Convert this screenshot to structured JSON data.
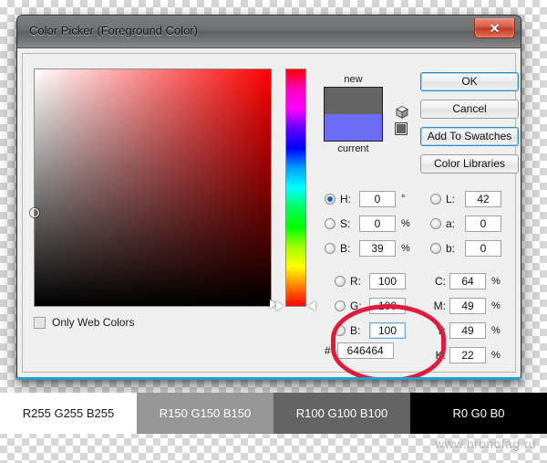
{
  "window": {
    "title": "Color Picker (Foreground Color)",
    "close_icon": "close-icon",
    "close_glyph": "✕"
  },
  "picker": {
    "sv_field_name": "saturation-brightness-field",
    "hue_slider_name": "hue-slider",
    "base_hue_color": "#ff0000",
    "only_web_colors_label": "Only Web Colors",
    "only_web_colors_checked": false
  },
  "preview": {
    "new_label": "new",
    "current_label": "current",
    "new_color": "#646464",
    "current_color": "#6b6bf5",
    "web_safe_square_color": "#646464",
    "cube_icon": "web-safe-warning-cube-icon"
  },
  "buttons": {
    "ok": "OK",
    "cancel": "Cancel",
    "add_to_swatches": "Add To Swatches",
    "color_libraries": "Color Libraries"
  },
  "fields": {
    "hsb": [
      {
        "label": "H:",
        "value": "0",
        "unit": "°",
        "selected": true
      },
      {
        "label": "S:",
        "value": "0",
        "unit": "%",
        "selected": false
      },
      {
        "label": "B:",
        "value": "39",
        "unit": "%",
        "selected": false
      }
    ],
    "rgb": [
      {
        "label": "R:",
        "value": "100",
        "unit": "",
        "selected": false
      },
      {
        "label": "G:",
        "value": "100",
        "unit": "",
        "selected": false
      },
      {
        "label": "B:",
        "value": "100",
        "unit": "",
        "selected": false
      }
    ],
    "lab": [
      {
        "label": "L:",
        "value": "42",
        "unit": "",
        "selected": false
      },
      {
        "label": "a:",
        "value": "0",
        "unit": "",
        "selected": false
      },
      {
        "label": "b:",
        "value": "0",
        "unit": "",
        "selected": false
      }
    ],
    "cmyk": [
      {
        "label": "C:",
        "value": "64",
        "unit": "%"
      },
      {
        "label": "M:",
        "value": "49",
        "unit": "%"
      },
      {
        "label": "Y:",
        "value": "49",
        "unit": "%"
      },
      {
        "label": "K:",
        "value": "22",
        "unit": "%"
      }
    ],
    "hex": {
      "hash": "#",
      "value": "646464"
    }
  },
  "annotation": {
    "highlight_color": "#e21b3c",
    "highlights": "rgb-fields"
  },
  "bottom_swatches": [
    {
      "label": "R255 G255 B255",
      "bg": "#ffffff",
      "fg": "#1a1a1a"
    },
    {
      "label": "R150 G150 B150",
      "bg": "#969696",
      "fg": "#ffffff"
    },
    {
      "label": "R100 G100 B100",
      "bg": "#646464",
      "fg": "#ffffff"
    },
    {
      "label": "R0 G0 B0",
      "bg": "#000000",
      "fg": "#ffffff"
    }
  ],
  "watermark": "www.hronofag.ru"
}
